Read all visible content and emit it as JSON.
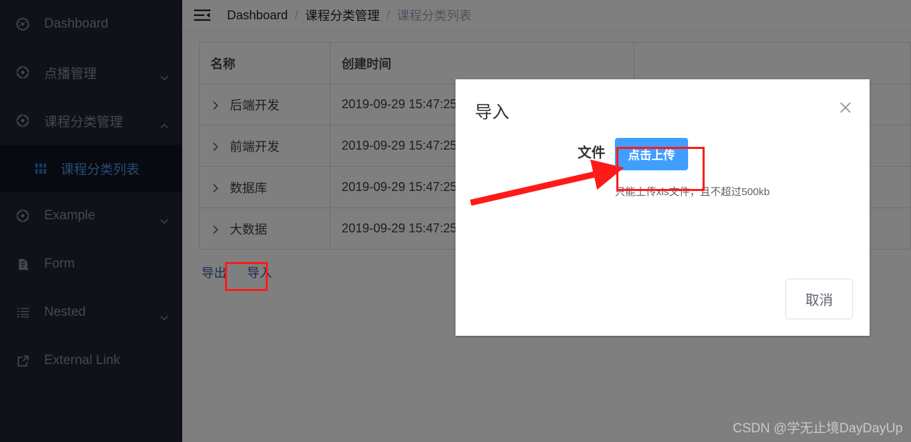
{
  "sidebar": {
    "items": [
      {
        "label": "Dashboard",
        "icon": "dashboard-icon",
        "has_arrow": false,
        "expanded": false,
        "active": false
      },
      {
        "label": "点播管理",
        "icon": "component-icon",
        "has_arrow": true,
        "expanded": false,
        "active": false
      },
      {
        "label": "课程分类管理",
        "icon": "component-icon",
        "has_arrow": true,
        "expanded": true,
        "active": false
      },
      {
        "label": "课程分类列表",
        "icon": "grid-icon",
        "has_arrow": false,
        "expanded": false,
        "active": true,
        "sub": true
      },
      {
        "label": "Example",
        "icon": "component-icon",
        "has_arrow": true,
        "expanded": false,
        "active": false
      },
      {
        "label": "Form",
        "icon": "form-icon",
        "has_arrow": false,
        "expanded": false,
        "active": false
      },
      {
        "label": "Nested",
        "icon": "nested-list-icon",
        "has_arrow": true,
        "expanded": false,
        "active": false
      },
      {
        "label": "External Link",
        "icon": "external-link-icon",
        "has_arrow": false,
        "expanded": false,
        "active": false
      }
    ],
    "colors": {
      "background": "#1f2533",
      "active_background": "#0f1420",
      "text": "#8a9199",
      "active_text": "#4e96e6"
    }
  },
  "navbar": {
    "hamburger_icon": "hamburger-collapse-icon",
    "breadcrumb": [
      {
        "label": "Dashboard",
        "current": false
      },
      {
        "label": "课程分类管理",
        "current": false
      },
      {
        "label": "课程分类列表",
        "current": true
      }
    ],
    "separator": "/"
  },
  "table": {
    "columns": [
      {
        "key": "name",
        "label": "名称"
      },
      {
        "key": "created",
        "label": "创建时间"
      },
      {
        "key": "blank",
        "label": ""
      }
    ],
    "rows": [
      {
        "expander": "chevron-right-icon",
        "name": "后端开发",
        "created": "2019-09-29 15:47:25"
      },
      {
        "expander": "chevron-right-icon",
        "name": "前端开发",
        "created": "2019-09-29 15:47:25"
      },
      {
        "expander": "chevron-right-icon",
        "name": "数据库",
        "created": "2019-09-29 15:47:25"
      },
      {
        "expander": "chevron-right-icon",
        "name": "大数据",
        "created": "2019-09-29 15:47:25"
      }
    ]
  },
  "actions": {
    "export_label": "导出",
    "import_label": "导入"
  },
  "modal": {
    "title": "导入",
    "close_icon": "close-icon",
    "file_label": "文件",
    "upload_button_label": "点击上传",
    "upload_tip": "只能上传xls文件，且不超过500kb",
    "cancel_label": "取消",
    "accent_color": "#409eff"
  },
  "annotations": {
    "highlight_color": "#ff1a1a",
    "boxes": [
      "import-link",
      "upload-button"
    ],
    "arrows": [
      "table-to-upload-button"
    ]
  },
  "watermark": {
    "text": "CSDN @学无止境DayDayUp"
  }
}
